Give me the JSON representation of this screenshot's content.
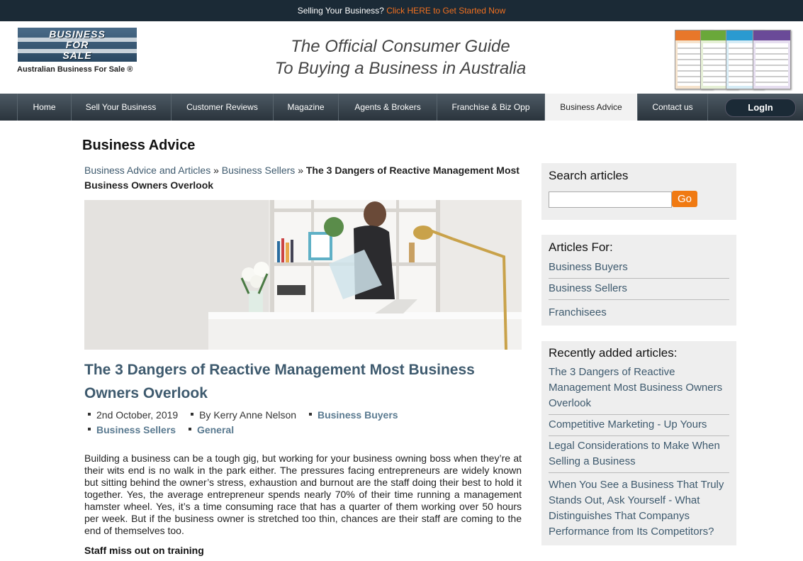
{
  "topbar": {
    "prefix": "Selling Your Business?",
    "cta": "Click HERE to Get Started Now"
  },
  "header": {
    "logo_text_1": "BUSINESS",
    "logo_text_2": "FOR",
    "logo_text_3": "SALE",
    "logo_sub": "Australian Business For Sale ®",
    "tagline_1": "The Official Consumer Guide",
    "tagline_2": "To Buying a Business in Australia"
  },
  "nav": {
    "items": [
      {
        "label": "Home"
      },
      {
        "label": "Sell Your Business"
      },
      {
        "label": "Customer Reviews"
      },
      {
        "label": "Magazine"
      },
      {
        "label": "Agents & Brokers"
      },
      {
        "label": "Franchise & Biz Opp"
      },
      {
        "label": "Business Advice"
      },
      {
        "label": "Contact us"
      }
    ],
    "active": "Business Advice",
    "login": "LogIn"
  },
  "page_title": "Business Advice",
  "breadcrumb": {
    "link1": "Business Advice and Articles",
    "sep": "»",
    "link2": "Business Sellers",
    "current": "The 3 Dangers of Reactive Management Most Business Owners Overlook"
  },
  "article": {
    "title": "The 3 Dangers of Reactive Management Most Business Owners Overlook",
    "date": "2nd October, 2019",
    "author": "By Kerry Anne Nelson",
    "categories": [
      "Business Buyers",
      "Business Sellers",
      "General"
    ],
    "body": "Building a business can be a tough gig, but working for your business owning boss when they’re at their wits end is no walk in the park either. The pressures facing entrepreneurs are widely known but sitting behind the owner’s stress, exhaustion and burnout are the staff doing their best to hold it together. Yes, the average entrepreneur spends nearly 70% of their time running a management hamster wheel. Yes, it’s a time consuming race that has a quarter of them working over 50 hours per week. But if the business owner is stretched too thin, chances are their staff are coming to the end of themselves too.",
    "subheading": "Staff miss out on training"
  },
  "sidebar": {
    "search": {
      "title": "Search articles",
      "value": "",
      "button": "Go"
    },
    "articles_for": {
      "title": "Articles For:",
      "items": [
        "Business Buyers",
        "Business Sellers",
        "Franchisees"
      ]
    },
    "recent": {
      "title": "Recently added articles:",
      "items": [
        "The 3 Dangers of Reactive Management Most Business Owners Overlook",
        "Competitive Marketing - Up Yours",
        "Legal Considerations to Make When Selling a Business",
        "When You See a Business That Truly Stands Out, Ask Yourself - What Distinguishes That Companys Performance from Its Competitors?"
      ]
    }
  },
  "colors": {
    "topbar_bg": "#1b2a36",
    "cta": "#f07020",
    "link": "#3e5a6e",
    "go_button": "#f07a12",
    "sidebar_bg": "#eeeeee"
  }
}
